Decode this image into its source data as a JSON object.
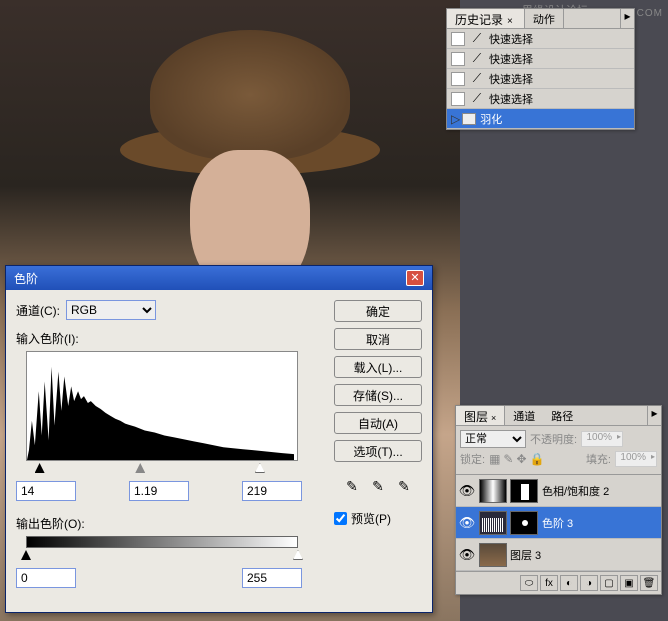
{
  "watermarks": {
    "top": "思缘设计论坛",
    "right": "WWW.MISSYUAN.COM"
  },
  "history": {
    "tabs": [
      "历史记录",
      "动作"
    ],
    "items": [
      {
        "label": "快速选择",
        "selected": false
      },
      {
        "label": "快速选择",
        "selected": false
      },
      {
        "label": "快速选择",
        "selected": false
      },
      {
        "label": "快速选择",
        "selected": false
      },
      {
        "label": "羽化",
        "selected": true
      }
    ]
  },
  "levels": {
    "title": "色阶",
    "channel_label": "通道(C):",
    "channel_value": "RGB",
    "input_label": "输入色阶(I):",
    "output_label": "输出色阶(O):",
    "input_values": {
      "black": "14",
      "mid": "1.19",
      "white": "219"
    },
    "output_values": {
      "black": "0",
      "white": "255"
    },
    "buttons": {
      "ok": "确定",
      "cancel": "取消",
      "load": "载入(L)...",
      "save": "存储(S)...",
      "auto": "自动(A)",
      "options": "选项(T)..."
    },
    "preview_label": "预览(P)"
  },
  "layers": {
    "tabs": [
      "图层",
      "通道",
      "路径"
    ],
    "blend_mode": "正常",
    "opacity_label": "不透明度:",
    "opacity_value": "100%",
    "lock_label": "锁定:",
    "fill_label": "填充:",
    "fill_value": "100%",
    "items": [
      {
        "name": "色相/饱和度 2",
        "selected": false
      },
      {
        "name": "色阶 3",
        "selected": true
      },
      {
        "name": "图层 3",
        "selected": false
      }
    ]
  },
  "chart_data": {
    "type": "histogram",
    "title": "色阶",
    "channel": "RGB",
    "input_range": [
      0,
      255
    ],
    "input_black": 14,
    "input_gamma": 1.19,
    "input_white": 219,
    "output_range": [
      0,
      255
    ],
    "output_black": 0,
    "output_white": 255,
    "description": "Image luminance histogram with left-skewed distribution, peak around dark-to-mid tones (approx 20-60), long tail toward highlights"
  }
}
